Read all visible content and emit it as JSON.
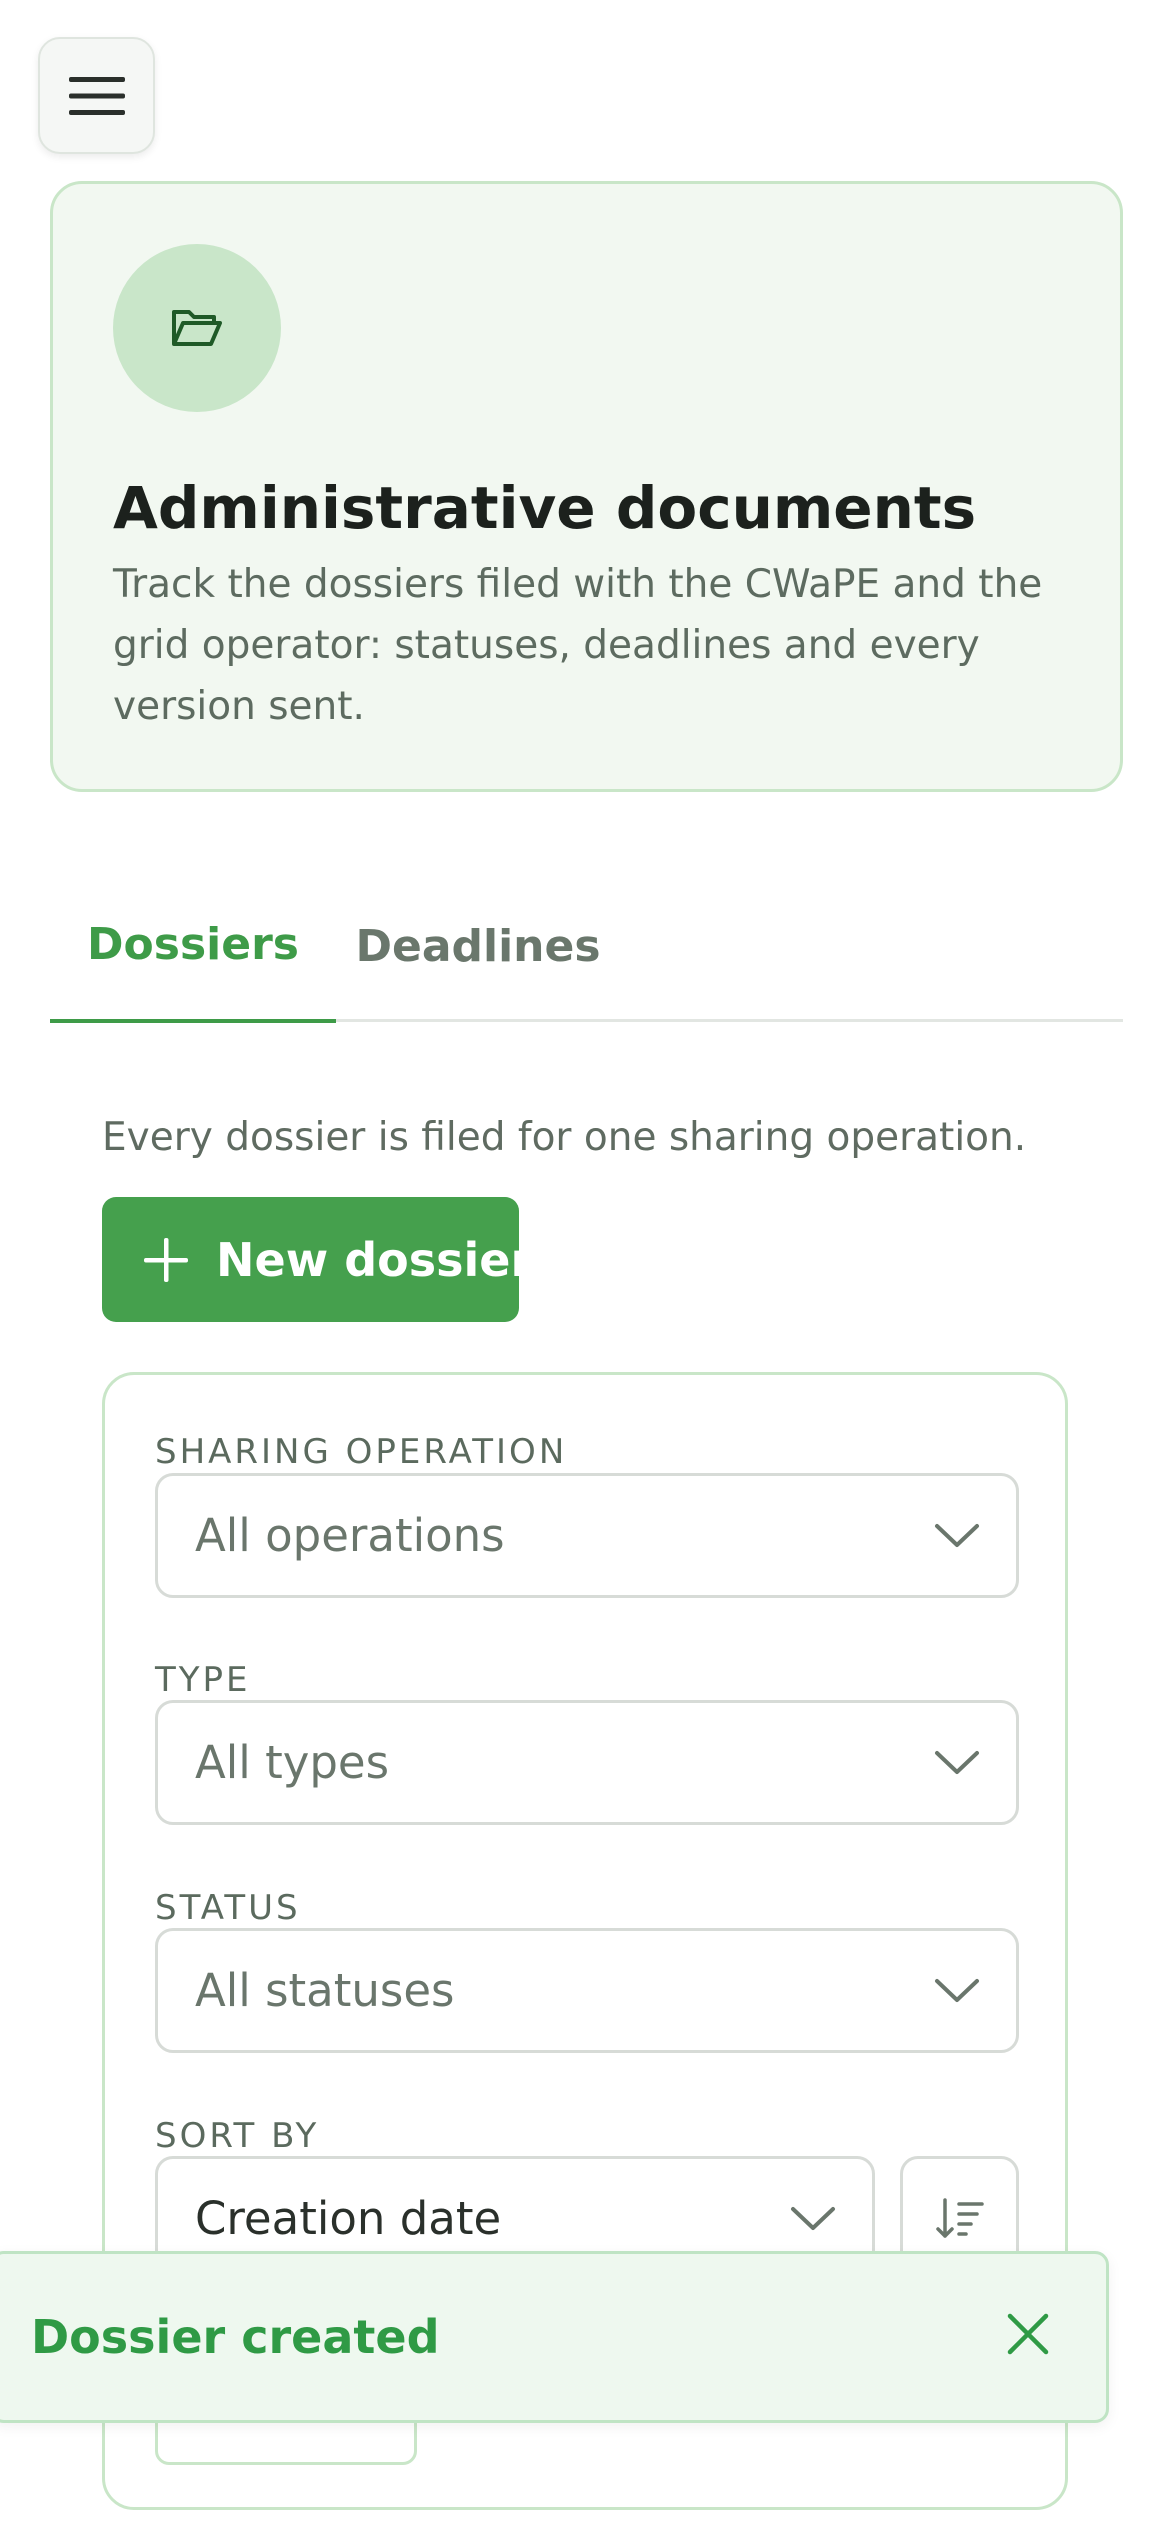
{
  "header": {
    "menu_icon": "hamburger-icon"
  },
  "hero": {
    "icon": "folder-open-icon",
    "title": "Administrative documents",
    "description": "Track the dossiers filed with the CWaPE and the grid operator: statuses, deadlines and every version sent."
  },
  "tabs": [
    {
      "label": "Dossiers",
      "active": true
    },
    {
      "label": "Deadlines",
      "active": false
    }
  ],
  "dossiers": {
    "description": "Every dossier is filed for one sharing operation.",
    "new_button_label": "New dossier"
  },
  "filters": {
    "operation_label": "SHARING OPERATION",
    "operation_value": "All operations",
    "type_label": "TYPE",
    "type_value": "All types",
    "status_label": "STATUS",
    "status_value": "All statuses",
    "sort_label": "SORT BY",
    "sort_value": "Creation date"
  },
  "toast": {
    "message": "Dossier created",
    "close_icon": "close-icon"
  },
  "colors": {
    "accent": "#45a04d",
    "accent_text": "#3e9b48",
    "hero_bg": "#f2f8f1",
    "border_green": "#c9e6c8",
    "toast_bg": "#eef8ef"
  }
}
